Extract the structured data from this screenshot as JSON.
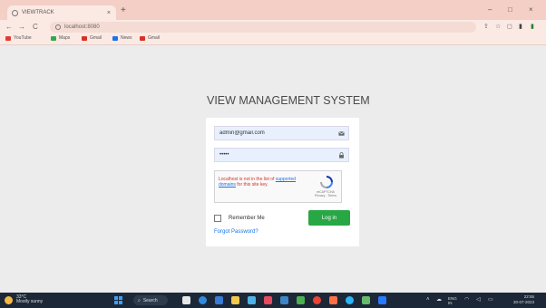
{
  "browser": {
    "tab_title": "VIEWTRACK",
    "tab_close": "×",
    "new_tab": "+",
    "window_controls": [
      "–",
      "□",
      "×"
    ],
    "nav": [
      "←",
      "→",
      "C"
    ],
    "address": "localhost:8080",
    "bookmarks": [
      {
        "label": "YouTube",
        "color": "#e53935"
      },
      {
        "label": "Maps",
        "color": "#34a853"
      },
      {
        "label": "Gmail",
        "color": "#d93025"
      },
      {
        "label": "News",
        "color": "#1a73e8"
      },
      {
        "label": "Gmail",
        "color": "#d93025"
      }
    ]
  },
  "login": {
    "title": "VIEW MANAGEMENT SYSTEM",
    "email_value": "admin@gmail.com",
    "password_value": "•••••",
    "captcha_message_pre": "Localhost is not in the list of",
    "captcha_message_link": "supported domains",
    "captcha_message_post": "for this site key.",
    "captcha_terms": "reCAPTCHA\nPrivacy - Terms",
    "remember_label": "Remember Me",
    "login_button": "Log in",
    "forgot_link": "Forgot Password?"
  },
  "taskbar": {
    "weather_temp": "33°C",
    "weather_text": "Mostly sunny",
    "search_label": "Search",
    "language": "ENG",
    "language_sub": "IN",
    "time": "22:55",
    "date": "30-07-2023"
  },
  "colors": {
    "accent_green": "#28a745",
    "link_blue": "#1a73e8",
    "error_red": "#d93025",
    "tab_strip": "#f3cfc6"
  }
}
